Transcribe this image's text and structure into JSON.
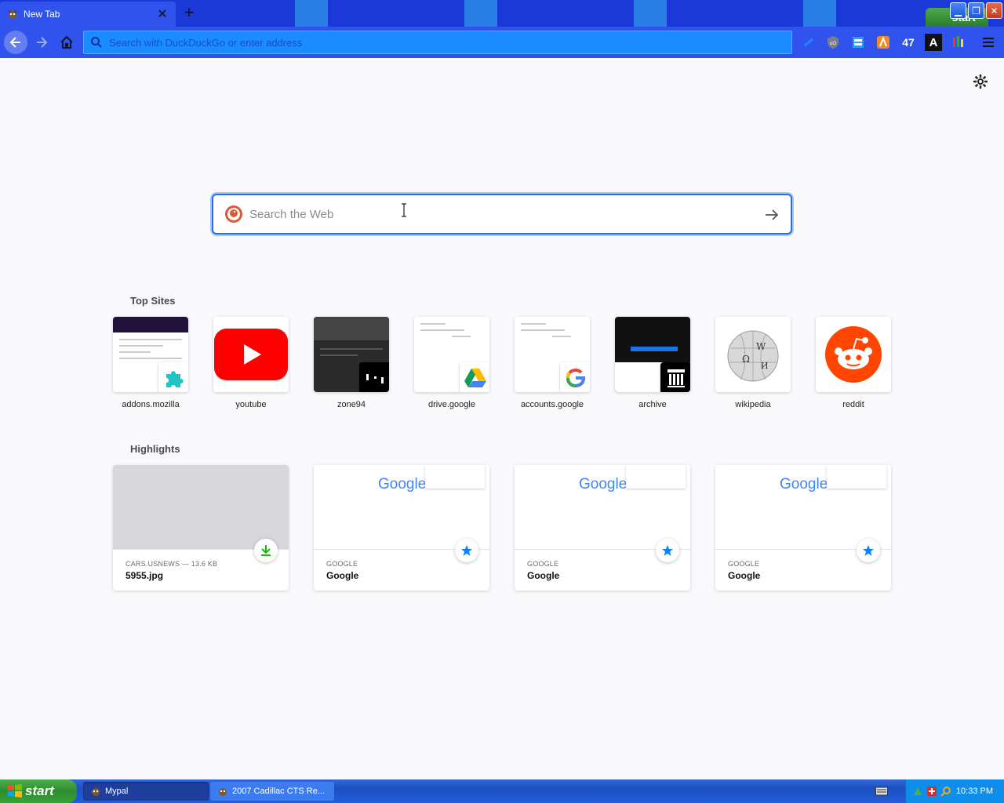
{
  "tab": {
    "title": "New Tab"
  },
  "urlbar": {
    "placeholder": "Search with DuckDuckGo or enter address"
  },
  "toolbar": {
    "counter": "47",
    "font_letter": "A"
  },
  "xp_badge": {
    "label": "start"
  },
  "search": {
    "placeholder": "Search the Web"
  },
  "top_sites": {
    "title": "Top Sites",
    "items": [
      {
        "label": "addons.mozilla"
      },
      {
        "label": "youtube"
      },
      {
        "label": "zone94"
      },
      {
        "label": "drive.google"
      },
      {
        "label": "accounts.google"
      },
      {
        "label": "archive"
      },
      {
        "label": "wikipedia"
      },
      {
        "label": "reddit"
      }
    ]
  },
  "highlights": {
    "title": "Highlights",
    "items": [
      {
        "source": "CARS.USNEWS — 13.6 KB",
        "title": "5955.jpg",
        "badge": "download-icon"
      },
      {
        "source": "GOOGLE",
        "title": "Google",
        "badge": "bookmark-star-icon",
        "preview_word": "Google"
      },
      {
        "source": "GOOGLE",
        "title": "Google",
        "badge": "bookmark-star-icon",
        "preview_word": "Google"
      },
      {
        "source": "GOOGLE",
        "title": "Google",
        "badge": "bookmark-star-icon",
        "preview_word": "Google"
      }
    ]
  },
  "taskbar": {
    "start_label": "start",
    "tasks": [
      {
        "label": "Mypal"
      },
      {
        "label": "2007 Cadillac CTS Re..."
      }
    ],
    "clock": "10:33 PM"
  },
  "colors": {
    "tabstrip": "#1a39d6",
    "navbar": "#2f53ec",
    "urlbar": "#1a8cff",
    "search_focus": "#2b6be6",
    "youtube_red": "#ff0000",
    "reddit_orange": "#ff4500",
    "bookmark_blue": "#0a84ff",
    "download_green": "#12bc00"
  }
}
